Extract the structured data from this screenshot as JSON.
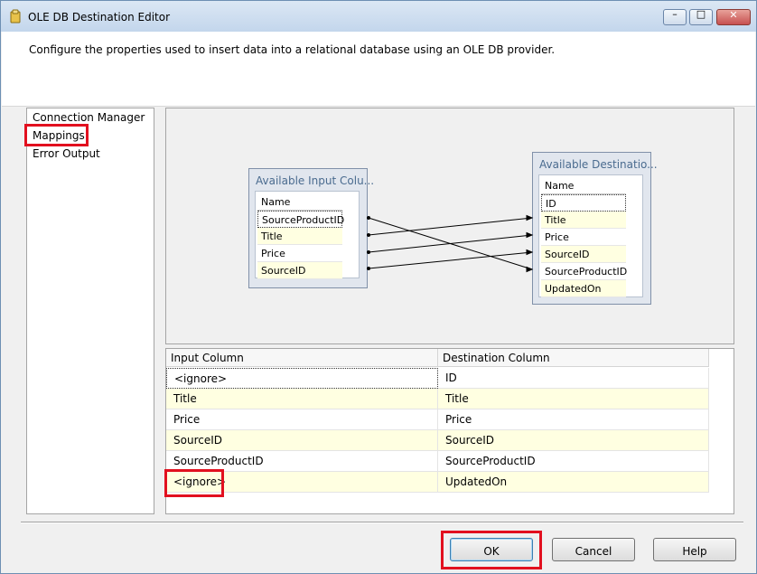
{
  "window": {
    "title": "OLE DB Destination Editor",
    "controls": {
      "minimize": "–",
      "maximize": "□",
      "close": "✕"
    }
  },
  "header": {
    "description": "Configure the properties used to insert data into a relational database using an OLE DB provider."
  },
  "nav": {
    "items": [
      {
        "label": "Connection Manager"
      },
      {
        "label": "Mappings",
        "selected": true
      },
      {
        "label": "Error Output"
      }
    ]
  },
  "mapping_diagram": {
    "input_box": {
      "title": "Available Input Colu...",
      "header": "Name",
      "columns": [
        "SourceProductID",
        "Title",
        "Price",
        "SourceID"
      ]
    },
    "destination_box": {
      "title": "Available Destinatio...",
      "header": "Name",
      "columns": [
        "ID",
        "Title",
        "Price",
        "SourceID",
        "SourceProductID",
        "UpdatedOn"
      ]
    }
  },
  "mapping_grid": {
    "headers": [
      "Input Column",
      "Destination Column"
    ],
    "rows": [
      {
        "input": "<ignore>",
        "destination": "ID"
      },
      {
        "input": "Title",
        "destination": "Title"
      },
      {
        "input": "Price",
        "destination": "Price"
      },
      {
        "input": "SourceID",
        "destination": "SourceID"
      },
      {
        "input": "SourceProductID",
        "destination": "SourceProductID"
      },
      {
        "input": "<ignore>",
        "destination": "UpdatedOn"
      }
    ]
  },
  "buttons": {
    "ok": "OK",
    "cancel": "Cancel",
    "help": "Help"
  },
  "colors": {
    "highlight": "#e2101f",
    "row_alt": "#ffffe1",
    "box_title": "#4a6b8f"
  }
}
